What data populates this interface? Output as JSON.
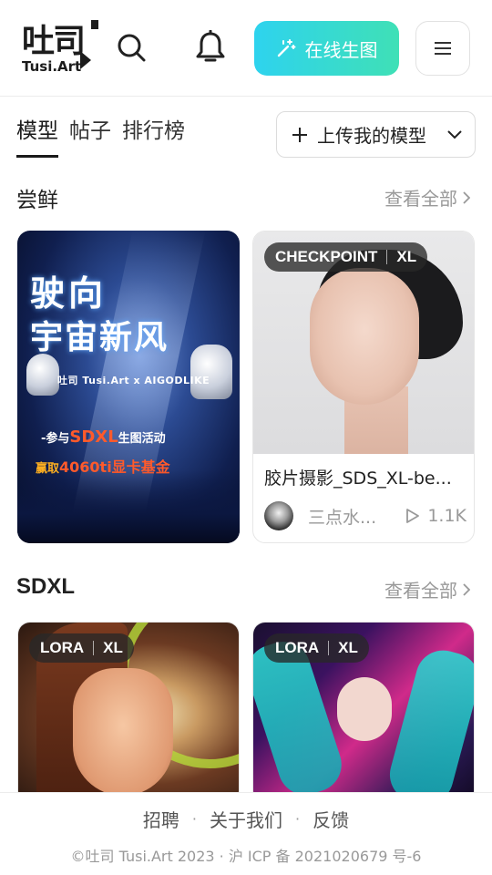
{
  "header": {
    "logo_cn": "吐司",
    "logo_en": "Tusi.Art",
    "generate_label": "在线生图"
  },
  "tabs": [
    {
      "label": "模型",
      "active": true
    },
    {
      "label": "帖子",
      "active": false
    },
    {
      "label": "排行榜",
      "active": false
    }
  ],
  "upload_label": "上传我的模型",
  "sections": {
    "taste": {
      "title": "尝鲜",
      "see_all": "查看全部"
    },
    "sdxl": {
      "title": "SDXL",
      "see_all": "查看全部"
    }
  },
  "poster": {
    "title_line1": "驶向",
    "title_line2": "宇宙新风",
    "collab": "吐司 Tusi.Art  x  AIGODLIKE",
    "line3_prefix": "-参与",
    "line3_highlight": "SDXL",
    "line3_suffix": "生图活动",
    "line4_prefix": "赢取",
    "line4_highlight": "4060ti显卡基金"
  },
  "model_card": {
    "badge_type": "CHECKPOINT",
    "badge_base": "XL",
    "title": "胶片摄影_SDS_XL-be...",
    "author": "三点水...",
    "plays": "1.1K"
  },
  "lora_cards": [
    {
      "badge_type": "LORA",
      "badge_base": "XL"
    },
    {
      "badge_type": "LORA",
      "badge_base": "XL"
    }
  ],
  "footer": {
    "links": [
      "招聘",
      "关于我们",
      "反馈"
    ],
    "copyright": "©吐司 Tusi.Art 2023 · 沪 ICP 备 2021020679 号-6"
  },
  "colors": {
    "generate_start": "#2ed3ee",
    "generate_end": "#3fe0b6",
    "muted_text": "#999999"
  }
}
